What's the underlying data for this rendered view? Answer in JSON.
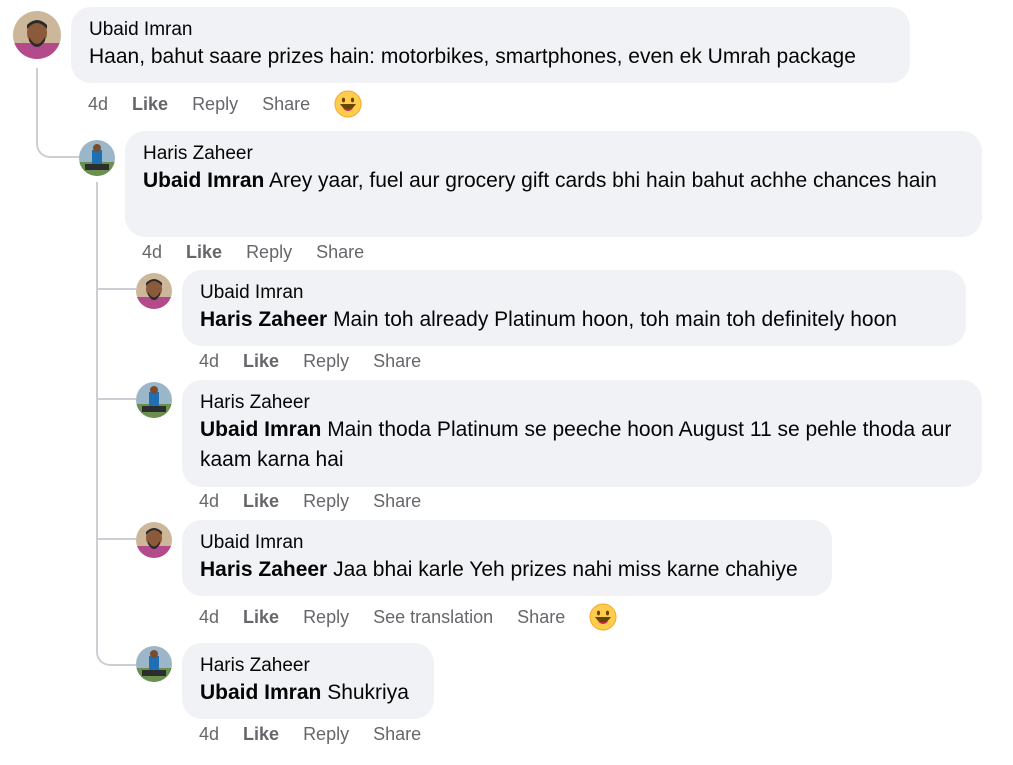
{
  "comments": [
    {
      "author": "Ubaid Imran",
      "mention": "",
      "text": "Haan, bahut saare prizes hain: motorbikes, smartphones, even ek Umrah package",
      "time": "4d",
      "like": "Like",
      "reply": "Reply",
      "share": "Share",
      "reaction": "grinning-face-emoji"
    },
    {
      "author": "Haris Zaheer",
      "mention": "Ubaid Imran",
      "text": " Arey yaar, fuel aur grocery gift cards bhi hain bahut achhe chances hain",
      "time": "4d",
      "like": "Like",
      "reply": "Reply",
      "share": "Share"
    },
    {
      "author": "Ubaid Imran",
      "mention": "Haris Zaheer",
      "text": " Main toh already Platinum hoon, toh main toh definitely hoon",
      "time": "4d",
      "like": "Like",
      "reply": "Reply",
      "share": "Share"
    },
    {
      "author": "Haris Zaheer",
      "mention": "Ubaid Imran",
      "text": " Main thoda Platinum se peeche hoon August 11 se pehle thoda aur kaam karna hai",
      "time": "4d",
      "like": "Like",
      "reply": "Reply",
      "share": "Share"
    },
    {
      "author": "Ubaid Imran",
      "mention": "Haris Zaheer",
      "text": " Jaa bhai karle Yeh prizes nahi miss karne chahiye",
      "time": "4d",
      "like": "Like",
      "reply": "Reply",
      "see_translation": "See translation",
      "share": "Share",
      "reaction": "grinning-face-emoji"
    },
    {
      "author": "Haris Zaheer",
      "mention": "Ubaid Imran",
      "text": " Shukriya",
      "time": "4d",
      "like": "Like",
      "reply": "Reply",
      "share": "Share"
    }
  ],
  "colors": {
    "bubble": "#f0f2f5",
    "meta_text": "#65676b",
    "thread_line": "#ccced3",
    "emoji_yellow": "#ffcc4d"
  }
}
